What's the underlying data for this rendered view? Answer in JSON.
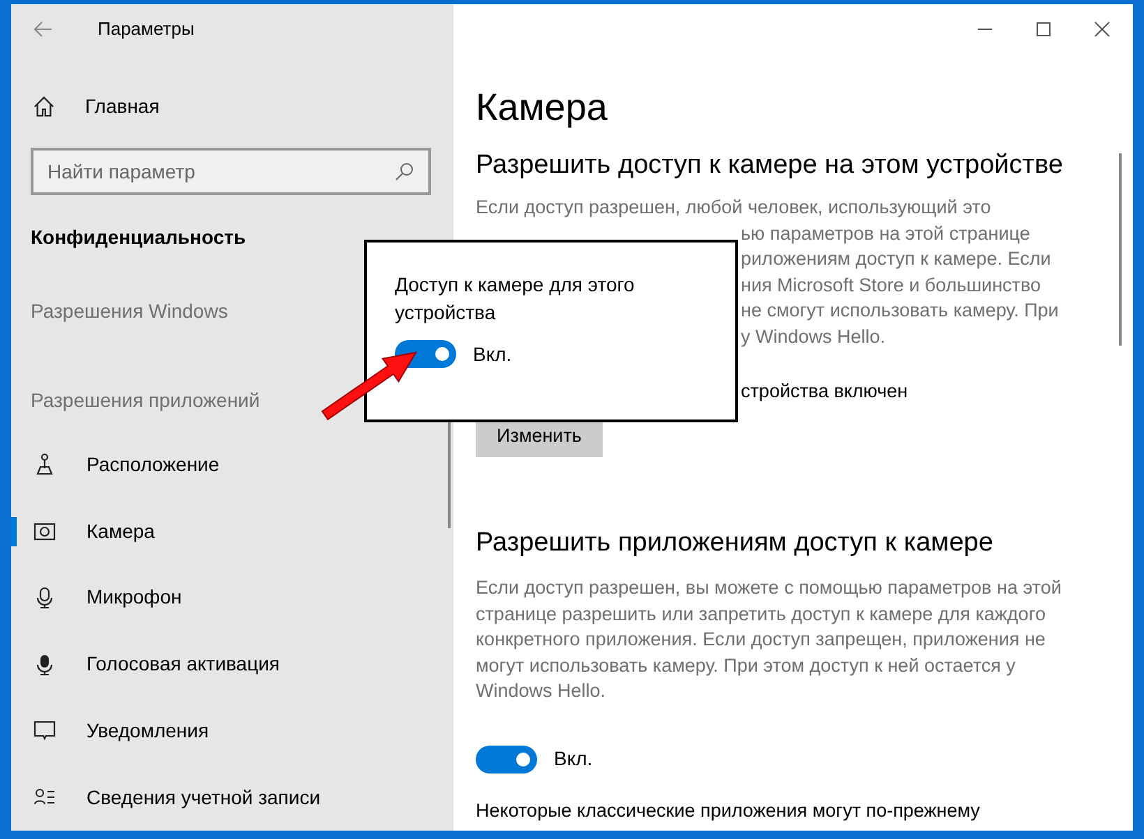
{
  "window": {
    "title": "Параметры"
  },
  "sidebar": {
    "home": "Главная",
    "search": {
      "placeholder": "Найти параметр"
    },
    "section": "Конфиденциальность",
    "items": [
      {
        "kind": "group",
        "label": "Разрешения Windows"
      },
      {
        "kind": "group",
        "label": "Разрешения приложений"
      },
      {
        "kind": "link",
        "label": "Расположение",
        "selected": false
      },
      {
        "kind": "link",
        "label": "Камера",
        "selected": true
      },
      {
        "kind": "link",
        "label": "Микрофон",
        "selected": false
      },
      {
        "kind": "link",
        "label": "Голосовая активация",
        "selected": false
      },
      {
        "kind": "link",
        "label": "Уведомления",
        "selected": false
      },
      {
        "kind": "link",
        "label": "Сведения учетной записи",
        "selected": false
      }
    ]
  },
  "main": {
    "title": "Камера",
    "device_section": {
      "heading": "Разрешить доступ к камере на этом устройстве",
      "lines": [
        "Если доступ разрешен, любой человек, использующий это",
        "ью параметров на этой странице",
        "риложениям доступ к камере. Если",
        "ния Microsoft Store и большинство",
        "не смогут использовать камеру. При",
        "у Windows Hello."
      ],
      "status": "стройства включен",
      "button": "Изменить"
    },
    "apps_section": {
      "heading": "Разрешить приложениям доступ к камере",
      "paragraph": "Если доступ разрешен, вы можете с помощью параметров на этой странице разрешить или запретить доступ к камере для каждого конкретного приложения. Если доступ запрещен, приложения не могут использовать камеру. При этом доступ к ней остается у Windows Hello.",
      "toggle": {
        "on": true,
        "label": "Вкл."
      },
      "note": "Некоторые классические приложения могут по-прежнему"
    }
  },
  "popup": {
    "title": "Доступ к камере для этого устройства",
    "toggle": {
      "on": true,
      "label": "Вкл."
    }
  }
}
